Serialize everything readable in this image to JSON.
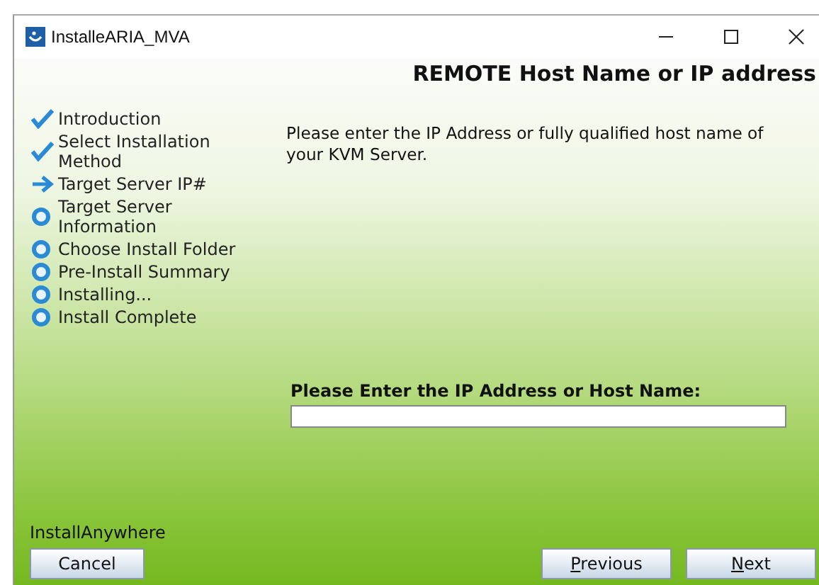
{
  "window": {
    "title": "InstalleARIA_MVA"
  },
  "header": {
    "title": "REMOTE Host Name or IP address"
  },
  "steps": [
    {
      "label": "Introduction",
      "kind": "done"
    },
    {
      "label": "Select Installation Method",
      "kind": "done"
    },
    {
      "label": "Target Server IP#",
      "kind": "current"
    },
    {
      "label": "Target Server Information",
      "kind": "pending"
    },
    {
      "label": "Choose Install Folder",
      "kind": "pending"
    },
    {
      "label": "Pre-Install Summary",
      "kind": "pending"
    },
    {
      "label": "Installing...",
      "kind": "pending"
    },
    {
      "label": "Install Complete",
      "kind": "pending"
    }
  ],
  "instructions": "Please enter the IP Address or fully qualified host name of your KVM Server.",
  "host_field": {
    "label": "Please Enter the IP Address or Host Name:"
  },
  "brand": "InstallAnywhere",
  "left_buttons": [
    {
      "label": "Cancel",
      "mnemonic": false
    }
  ],
  "right_buttons": [
    {
      "label": "Previous",
      "mnemonic": true
    },
    {
      "label": "Next",
      "mnemonic": true
    }
  ]
}
